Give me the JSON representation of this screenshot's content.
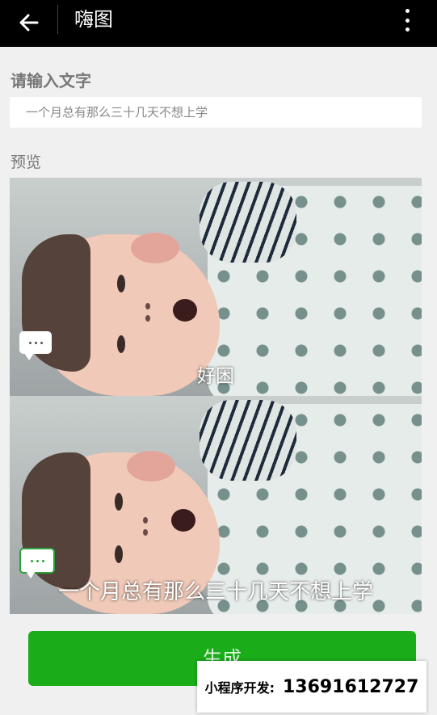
{
  "topbar": {
    "title": "嗨图",
    "back_icon": "arrow-left-icon",
    "more_icon": "more-vertical-icon"
  },
  "form": {
    "input_label": "请输入文字",
    "input_value": "一个月总有那么三十几天不想上学"
  },
  "preview": {
    "label": "预览",
    "frames": [
      {
        "caption": "好困",
        "bubble_icon": "chat-bubble-icon"
      },
      {
        "caption": "一个月总有那么三十几天不想上学",
        "bubble_icon": "chat-bubble-icon"
      }
    ]
  },
  "actions": {
    "generate_label": "生成"
  },
  "ad_banner": {
    "label": "小程序开发:",
    "phone": "13691612727"
  },
  "colors": {
    "topbar": "#000000",
    "background": "#f0f0f0",
    "button": "#1aad19"
  }
}
